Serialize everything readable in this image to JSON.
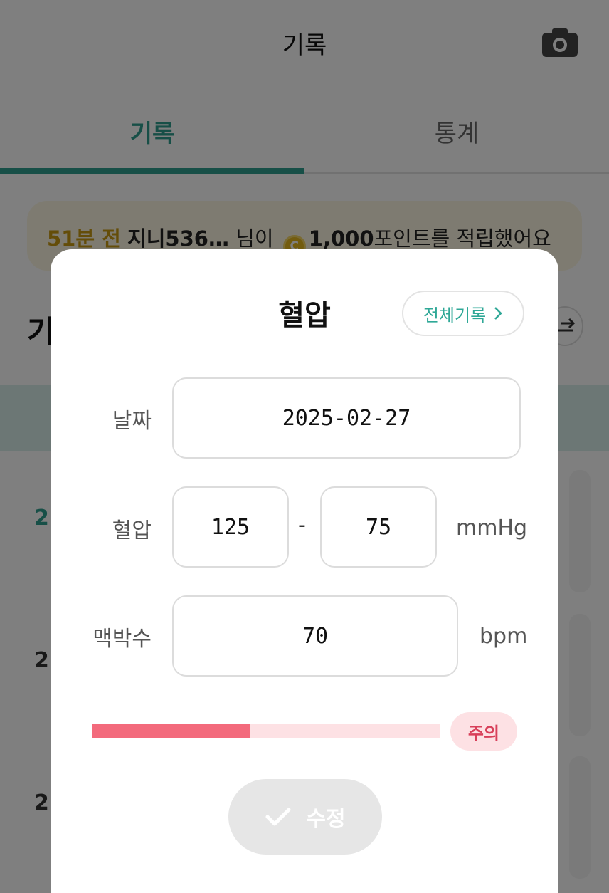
{
  "header": {
    "title": "기록"
  },
  "tabs": [
    {
      "label": "기록"
    },
    {
      "label": "통계"
    }
  ],
  "banner": {
    "time": "51분 전",
    "user": "지니536…",
    "suffix1": "님이",
    "coin_symbol": "C",
    "points": "1,000",
    "suffix2": "포인트를 적립했어요"
  },
  "section": {
    "title": "기"
  },
  "list": {
    "row_dates": [
      "2",
      "2",
      "2"
    ]
  },
  "modal": {
    "title": "혈압",
    "all_records_label": "전체기록",
    "date_label": "날짜",
    "date_value": "2025-02-27",
    "bp_label": "혈압",
    "systolic": "125",
    "dash": "-",
    "diastolic": "75",
    "bp_unit": "mmHg",
    "pulse_label": "맥박수",
    "pulse_value": "70",
    "pulse_unit": "bpm",
    "status_level": 0.455,
    "status_label": "주의",
    "submit_label": "수정"
  },
  "colors": {
    "accent": "#2f9e8f",
    "warning": "#f36a7c",
    "warning_bg": "#fde1e4",
    "coin": "#e6b81f"
  },
  "icons": {
    "camera": "camera-icon",
    "chevron": "chevron-right-icon",
    "check": "check-icon",
    "sort": "sort-icon",
    "coin": "coin-icon"
  }
}
